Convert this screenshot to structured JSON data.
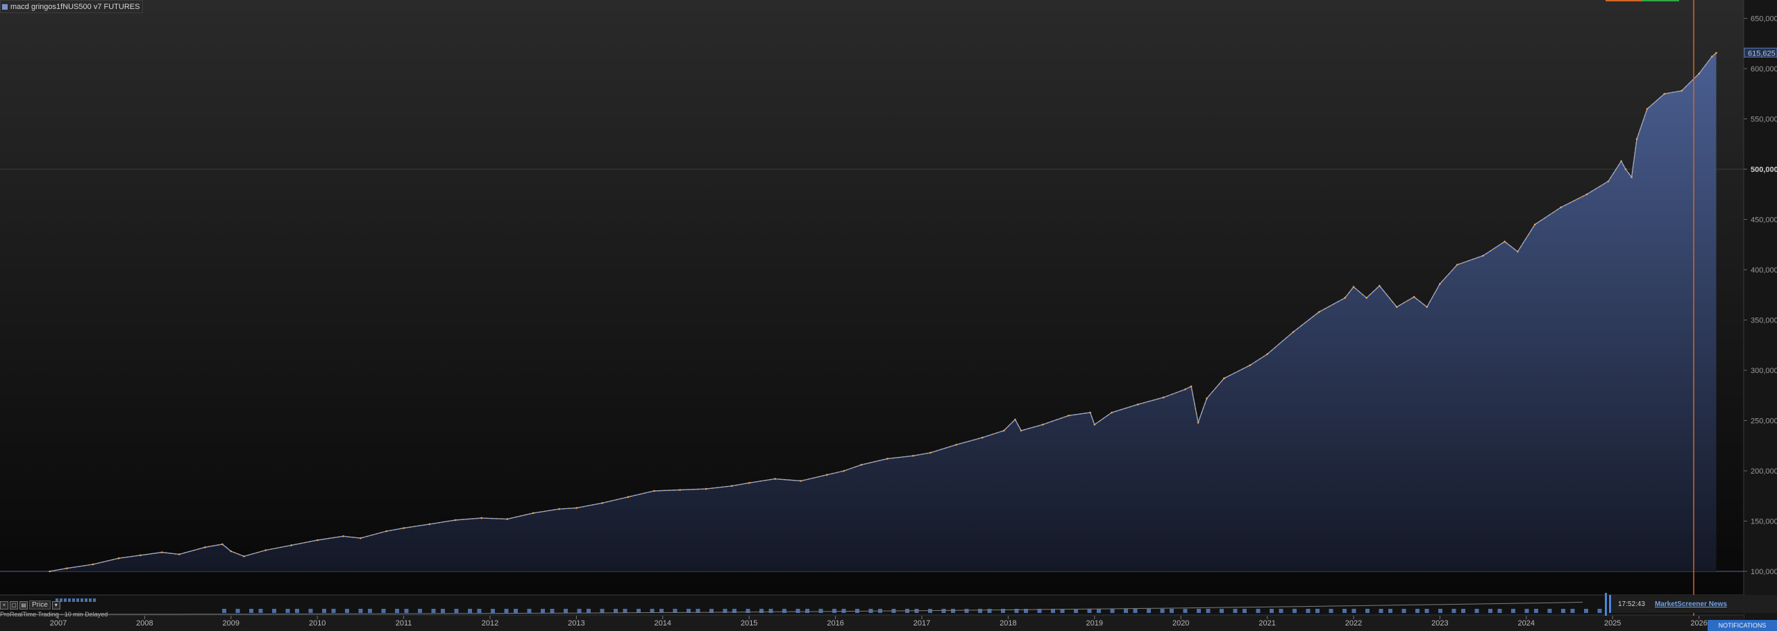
{
  "window": {
    "title": "macd gringos1fNUS500 v7 FUTURES",
    "price_button": "Price",
    "delayed_note": "ProRealTime Trading - 10 min Delayed"
  },
  "price_axis": {
    "ticks": [
      "100,000",
      "150,000",
      "200,000",
      "250,000",
      "300,000",
      "350,000",
      "400,000",
      "450,000",
      "500,000",
      "550,000",
      "600,000",
      "650,000"
    ],
    "current_value": "615,625"
  },
  "time_axis": {
    "years": [
      "2007",
      "2008",
      "2009",
      "2010",
      "2011",
      "2012",
      "2013",
      "2014",
      "2015",
      "2016",
      "2017",
      "2018",
      "2019",
      "2020",
      "2021",
      "2022",
      "2023",
      "2024",
      "2025",
      "2026"
    ]
  },
  "news": {
    "time": "17:52:43",
    "link_label": "MarketScreener News"
  },
  "notifications_button": "NOTIFICATIONS",
  "colors": {
    "line": "#e8a35a",
    "line_alt": "#7fa3e0",
    "area_top": "#4a5f92",
    "area_bottom": "#161a28",
    "cursor": "#d4662a",
    "background_top": "#2a2a2a",
    "background_bottom": "#0a0a0a"
  },
  "chart_data": {
    "type": "area",
    "title": "macd gringos1fNUS500 v7 FUTURES",
    "xlabel": "",
    "ylabel": "",
    "ylim": [
      75000,
      665000
    ],
    "xlim": [
      2006.9,
      2026.5
    ],
    "grid": false,
    "series": [
      {
        "values": [
          [
            2006.9,
            100000
          ],
          [
            2007.1,
            103000
          ],
          [
            2007.4,
            107000
          ],
          [
            2007.7,
            113000
          ],
          [
            2007.95,
            116000
          ],
          [
            2008.2,
            119000
          ],
          [
            2008.4,
            117000
          ],
          [
            2008.7,
            124000
          ],
          [
            2008.9,
            127000
          ],
          [
            2009.0,
            120000
          ],
          [
            2009.15,
            115000
          ],
          [
            2009.4,
            121000
          ],
          [
            2009.7,
            126000
          ],
          [
            2010.0,
            131000
          ],
          [
            2010.3,
            135000
          ],
          [
            2010.5,
            133000
          ],
          [
            2010.8,
            140000
          ],
          [
            2011.0,
            143000
          ],
          [
            2011.3,
            147000
          ],
          [
            2011.6,
            151000
          ],
          [
            2011.9,
            153000
          ],
          [
            2012.2,
            152000
          ],
          [
            2012.5,
            158000
          ],
          [
            2012.8,
            162000
          ],
          [
            2013.0,
            163000
          ],
          [
            2013.3,
            168000
          ],
          [
            2013.6,
            174000
          ],
          [
            2013.9,
            180000
          ],
          [
            2014.2,
            181000
          ],
          [
            2014.5,
            182000
          ],
          [
            2014.8,
            185000
          ],
          [
            2015.0,
            188000
          ],
          [
            2015.3,
            192000
          ],
          [
            2015.6,
            190000
          ],
          [
            2015.9,
            196000
          ],
          [
            2016.1,
            200000
          ],
          [
            2016.3,
            206000
          ],
          [
            2016.6,
            212000
          ],
          [
            2016.9,
            215000
          ],
          [
            2017.1,
            218000
          ],
          [
            2017.4,
            226000
          ],
          [
            2017.7,
            233000
          ],
          [
            2017.95,
            240000
          ],
          [
            2018.08,
            251000
          ],
          [
            2018.15,
            240000
          ],
          [
            2018.4,
            246000
          ],
          [
            2018.7,
            255000
          ],
          [
            2018.95,
            258000
          ],
          [
            2019.0,
            246000
          ],
          [
            2019.2,
            258000
          ],
          [
            2019.5,
            266000
          ],
          [
            2019.8,
            273000
          ],
          [
            2020.05,
            281000
          ],
          [
            2020.12,
            284000
          ],
          [
            2020.2,
            248000
          ],
          [
            2020.3,
            272000
          ],
          [
            2020.5,
            292000
          ],
          [
            2020.8,
            305000
          ],
          [
            2021.0,
            316000
          ],
          [
            2021.3,
            338000
          ],
          [
            2021.6,
            358000
          ],
          [
            2021.9,
            372000
          ],
          [
            2022.0,
            383000
          ],
          [
            2022.15,
            372000
          ],
          [
            2022.3,
            384000
          ],
          [
            2022.5,
            363000
          ],
          [
            2022.7,
            373000
          ],
          [
            2022.85,
            363000
          ],
          [
            2023.0,
            386000
          ],
          [
            2023.2,
            405000
          ],
          [
            2023.5,
            414000
          ],
          [
            2023.75,
            428000
          ],
          [
            2023.9,
            418000
          ],
          [
            2024.1,
            445000
          ],
          [
            2024.4,
            462000
          ],
          [
            2024.7,
            475000
          ],
          [
            2024.95,
            488000
          ],
          [
            2025.1,
            508000
          ],
          [
            2025.15,
            500000
          ],
          [
            2025.22,
            492000
          ],
          [
            2025.28,
            530000
          ],
          [
            2025.4,
            560000
          ],
          [
            2025.6,
            575000
          ],
          [
            2025.8,
            578000
          ],
          [
            2026.0,
            595000
          ],
          [
            2026.15,
            612000
          ],
          [
            2026.2,
            615625
          ]
        ]
      }
    ],
    "current_value": 615625
  }
}
